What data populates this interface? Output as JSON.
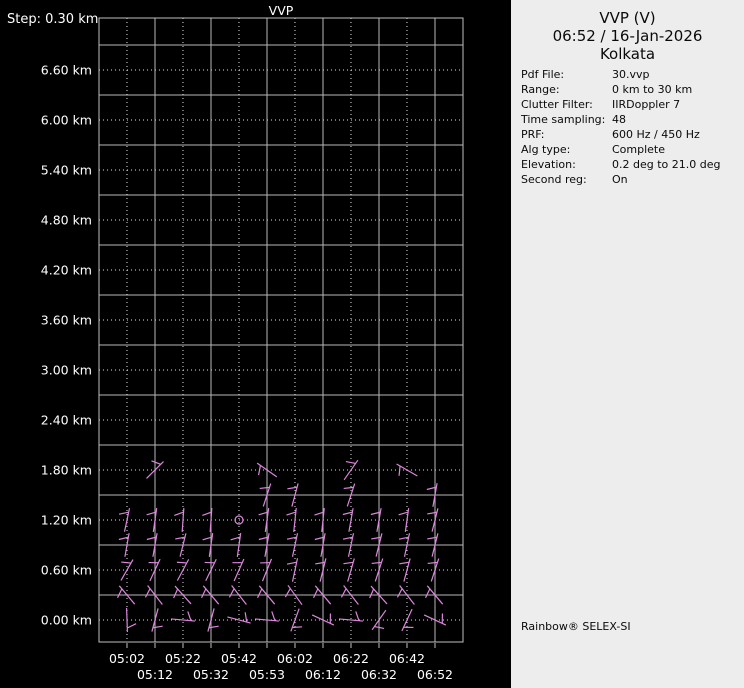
{
  "chart_data": {
    "type": "wind-barb-time-height-profile",
    "title": "VVP",
    "step_label": "Step: 0.30 km",
    "y_axis_labels": [
      "6.60 km",
      "6.00 km",
      "5.40 km",
      "4.80 km",
      "4.20 km",
      "3.60 km",
      "3.00 km",
      "2.40 km",
      "1.80 km",
      "1.20 km",
      "0.60 km",
      "0.00 km"
    ],
    "y_unit": "km",
    "y_step_km": 0.3,
    "x_labels_row1": [
      "05:02",
      "05:22",
      "05:42",
      "06:02",
      "06:22",
      "06:42"
    ],
    "x_labels_row2": [
      "05:12",
      "05:32",
      "05:53",
      "06:12",
      "06:32",
      "06:52"
    ],
    "times": [
      "05:02",
      "05:12",
      "05:22",
      "05:32",
      "05:42",
      "05:53",
      "06:02",
      "06:12",
      "06:22",
      "06:32",
      "06:42",
      "06:52"
    ],
    "calm": {
      "t": "05:42",
      "km": 1.2
    },
    "barbs": [
      {
        "t": "05:12",
        "km": 1.8,
        "a": 45
      },
      {
        "t": "05:53",
        "km": 1.8,
        "a": -55
      },
      {
        "t": "06:22",
        "km": 1.8,
        "a": 35
      },
      {
        "t": "06:42",
        "km": 1.8,
        "a": -60
      },
      {
        "t": "05:53",
        "km": 1.5,
        "a": 18
      },
      {
        "t": "06:02",
        "km": 1.5,
        "a": 15
      },
      {
        "t": "06:22",
        "km": 1.5,
        "a": 18
      },
      {
        "t": "06:52",
        "km": 1.5,
        "a": 10
      },
      {
        "t": "05:02",
        "km": 1.2,
        "a": 12
      },
      {
        "t": "05:12",
        "km": 1.2,
        "a": 8
      },
      {
        "t": "05:22",
        "km": 1.2,
        "a": 4
      },
      {
        "t": "05:32",
        "km": 1.2,
        "a": 4
      },
      {
        "t": "05:53",
        "km": 1.2,
        "a": 8
      },
      {
        "t": "06:02",
        "km": 1.2,
        "a": 6
      },
      {
        "t": "06:12",
        "km": 1.2,
        "a": 6
      },
      {
        "t": "06:22",
        "km": 1.2,
        "a": 10
      },
      {
        "t": "06:32",
        "km": 1.2,
        "a": 10
      },
      {
        "t": "06:42",
        "km": 1.2,
        "a": 8
      },
      {
        "t": "06:52",
        "km": 1.2,
        "a": 14
      },
      {
        "t": "05:02",
        "km": 0.9,
        "a": 10
      },
      {
        "t": "05:12",
        "km": 0.9,
        "a": 10
      },
      {
        "t": "05:22",
        "km": 0.9,
        "a": 14
      },
      {
        "t": "05:32",
        "km": 0.9,
        "a": 8
      },
      {
        "t": "05:42",
        "km": 0.9,
        "a": 8
      },
      {
        "t": "05:53",
        "km": 0.9,
        "a": 10
      },
      {
        "t": "06:02",
        "km": 0.9,
        "a": 12
      },
      {
        "t": "06:12",
        "km": 0.9,
        "a": 10
      },
      {
        "t": "06:22",
        "km": 0.9,
        "a": 12
      },
      {
        "t": "06:32",
        "km": 0.9,
        "a": 14
      },
      {
        "t": "06:42",
        "km": 0.9,
        "a": 12
      },
      {
        "t": "06:52",
        "km": 0.9,
        "a": 14
      },
      {
        "t": "05:02",
        "km": 0.6,
        "a": 30
      },
      {
        "t": "05:12",
        "km": 0.6,
        "a": 25
      },
      {
        "t": "05:22",
        "km": 0.6,
        "a": 28
      },
      {
        "t": "05:32",
        "km": 0.6,
        "a": 26
      },
      {
        "t": "05:42",
        "km": 0.6,
        "a": 24
      },
      {
        "t": "05:53",
        "km": 0.6,
        "a": 22
      },
      {
        "t": "06:02",
        "km": 0.6,
        "a": 12
      },
      {
        "t": "06:12",
        "km": 0.6,
        "a": 14
      },
      {
        "t": "06:22",
        "km": 0.6,
        "a": 16
      },
      {
        "t": "06:32",
        "km": 0.6,
        "a": 18
      },
      {
        "t": "06:42",
        "km": 0.6,
        "a": 15
      },
      {
        "t": "06:52",
        "km": 0.6,
        "a": 18
      },
      {
        "t": "05:02",
        "km": 0.3,
        "a": -40
      },
      {
        "t": "05:12",
        "km": 0.3,
        "a": -38
      },
      {
        "t": "05:22",
        "km": 0.3,
        "a": -42
      },
      {
        "t": "05:32",
        "km": 0.3,
        "a": -40
      },
      {
        "t": "05:42",
        "km": 0.3,
        "a": -38
      },
      {
        "t": "05:53",
        "km": 0.3,
        "a": -40
      },
      {
        "t": "06:02",
        "km": 0.3,
        "a": -36
      },
      {
        "t": "06:12",
        "km": 0.3,
        "a": -40
      },
      {
        "t": "06:22",
        "km": 0.3,
        "a": -38
      },
      {
        "t": "06:32",
        "km": 0.3,
        "a": -42
      },
      {
        "t": "06:42",
        "km": 0.3,
        "a": -38
      },
      {
        "t": "06:52",
        "km": 0.3,
        "a": -40
      },
      {
        "t": "05:02",
        "km": 0.0,
        "a": 178
      },
      {
        "t": "05:12",
        "km": 0.0,
        "a": 195
      },
      {
        "t": "05:22",
        "km": 0.0,
        "a": 95
      },
      {
        "t": "05:32",
        "km": 0.0,
        "a": 195
      },
      {
        "t": "05:42",
        "km": 0.0,
        "a": 105
      },
      {
        "t": "05:53",
        "km": 0.0,
        "a": 95
      },
      {
        "t": "06:02",
        "km": 0.0,
        "a": 200
      },
      {
        "t": "06:12",
        "km": 0.0,
        "a": 115
      },
      {
        "t": "06:22",
        "km": 0.0,
        "a": 95
      },
      {
        "t": "06:32",
        "km": 0.0,
        "a": 215
      },
      {
        "t": "06:42",
        "km": 0.0,
        "a": 205
      },
      {
        "t": "06:52",
        "km": 0.0,
        "a": 115
      }
    ],
    "colors": {
      "background": "#000000",
      "barb": "#dc86dc",
      "grid_solid": "#b8b8b8",
      "grid_dotted": "#e0e0e0",
      "frame": "#c0c0c0",
      "axis_text": "#ffffff"
    }
  },
  "panel": {
    "title": "VVP (V)",
    "datetime": "06:52 / 16-Jan-2026",
    "site": "Kolkata",
    "info": [
      {
        "label": "Pdf File:",
        "value": "30.vvp"
      },
      {
        "label": "Range:",
        "value": "0 km to 30 km"
      },
      {
        "label": "Clutter Filter:",
        "value": "IIRDoppler 7"
      },
      {
        "label": "Time sampling:",
        "value": "48"
      },
      {
        "label": "PRF:",
        "value": "600 Hz / 450 Hz"
      },
      {
        "label": "Alg type:",
        "value": "Complete"
      },
      {
        "label": "Elevation:",
        "value": "0.2 deg to 21.0 deg"
      },
      {
        "label": "Second reg:",
        "value": "On"
      }
    ],
    "branding": "Rainbow® SELEX-SI",
    "background": "#ededed"
  }
}
